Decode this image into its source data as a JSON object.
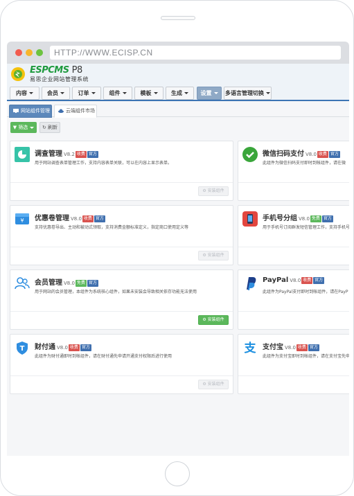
{
  "browser": {
    "url": "HTTP://WWW.ECISP.CN"
  },
  "logo": {
    "brand": "ESPCMS",
    "version": "P8",
    "subtitle": "易思企业网站管理系统"
  },
  "nav": {
    "items": [
      {
        "label": "内容"
      },
      {
        "label": "会员"
      },
      {
        "label": "订单"
      },
      {
        "label": "组件"
      },
      {
        "label": "模板"
      },
      {
        "label": "生成"
      },
      {
        "label": "设置"
      },
      {
        "label": "多语言管理切换"
      }
    ]
  },
  "tabs": [
    {
      "label": "网站组件管理"
    },
    {
      "label": "云端组件市场"
    }
  ],
  "toolbar": {
    "filter_label": "筛选",
    "refresh_label": "刷新"
  },
  "cards": [
    {
      "title": "调查管理",
      "version": "V8.2",
      "badge1": "收费",
      "badge2": "官方",
      "desc": "用于网站调查表单管理工作，支持内容表单关联，可以在内容上显示表单。",
      "button": "安装组件"
    },
    {
      "title": "微信扫码支付",
      "version": "V8.0",
      "badge1": "收费",
      "badge2": "官方",
      "desc": "此组件为微信扫码支付即时到帐组件，请在微",
      "button": "安装组件"
    },
    {
      "title": "优惠卷管理",
      "version": "V8.0",
      "badge1": "收费",
      "badge2": "官方",
      "desc": "支持优惠卷导出、主动和被动式领取，支持消费金额标准定义，指定商口使用定义等",
      "button": "安装组件"
    },
    {
      "title": "手机号分组",
      "version": "V8.0",
      "badge1": "免费",
      "badge2": "官方",
      "desc": "用于手机号订阅群发短信管理工作，支持手机号添",
      "button": "安装组件"
    },
    {
      "title": "会员管理",
      "version": "V8.0",
      "badge1": "免费",
      "badge2": "官方",
      "desc": "用于网站的会员管理，本组件为系统核心组件，如果未安装会导致相关依存功能无法使用",
      "button": "安装组件"
    },
    {
      "title": "PayPal",
      "version": "V8.0",
      "badge1": "收费",
      "badge2": "官方",
      "desc": "此组件为PayPal支付即时到帐组件，请在PayP",
      "button": "安装组件"
    },
    {
      "title": "财付通",
      "version": "V8.0",
      "badge1": "收费",
      "badge2": "官方",
      "desc": "此组件为财付通即时到帐组件，请在财付通先申请开通支付权限后进行使用",
      "button": "安装组件"
    },
    {
      "title": "支付宝",
      "version": "V8.0",
      "badge1": "收费",
      "badge2": "官方",
      "desc": "此组件为支付宝即时到帐组件，请在支付宝先申",
      "button": "安装组件"
    }
  ],
  "colors": {
    "nav_active": "#8fa9c6",
    "tab_active": "#5c88bb",
    "badge_charge": "#d9534f",
    "badge_official": "#3f6fae",
    "badge_free": "#5cb85c",
    "install_primary": "#5cb85c"
  },
  "icons": {
    "survey": "pie-chart-icon",
    "wechat": "wechat-check-icon",
    "coupon": "wallet-icon",
    "phone": "mobile-phone-icon",
    "member": "users-icon",
    "paypal": "paypal-icon",
    "tenpay": "shield-t-icon",
    "alipay": "alipay-icon"
  }
}
